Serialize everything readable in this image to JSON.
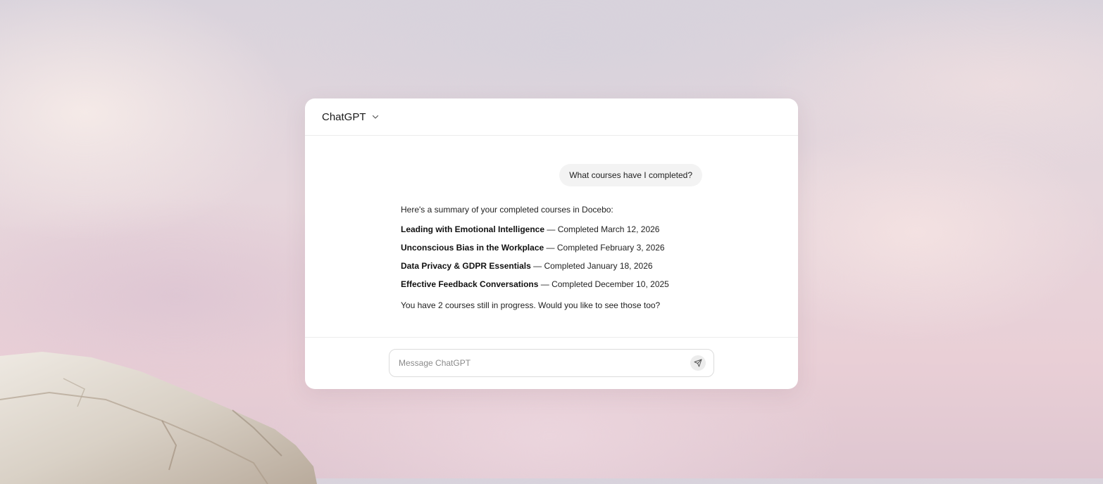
{
  "header": {
    "model_name": "ChatGPT",
    "model_selector_icon": "chevron-down-icon"
  },
  "conversation": {
    "user_message": "What courses have I completed?",
    "assistant": {
      "intro": "Here's a summary of your completed courses in Docebo:",
      "courses": [
        {
          "title": "Leading with Emotional Intelligence",
          "status": "— Completed March 12, 2026"
        },
        {
          "title": "Unconscious Bias in the Workplace",
          "status": "— Completed February 3, 2026"
        },
        {
          "title": "Data Privacy & GDPR Essentials",
          "status": "— Completed January 18, 2026"
        },
        {
          "title": "Effective Feedback Conversations",
          "status": "— Completed December 10, 2025"
        }
      ],
      "outro": "You have 2 courses still in progress. Would you like to see those too?"
    }
  },
  "composer": {
    "placeholder": "Message ChatGPT",
    "value": "",
    "send_icon": "send-icon"
  },
  "colors": {
    "window_bg": "#ffffff",
    "user_bubble_bg": "#f3f3f3",
    "send_button_bg": "#ececec"
  }
}
